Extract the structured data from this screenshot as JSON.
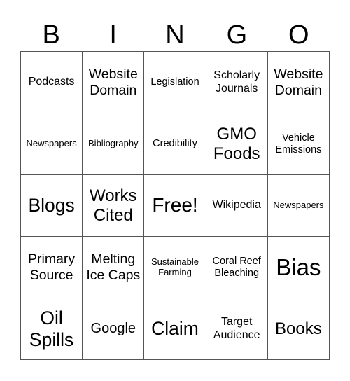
{
  "header": [
    "B",
    "I",
    "N",
    "G",
    "O"
  ],
  "cells": [
    [
      "Podcasts",
      "Website Domain",
      "Legislation",
      "Scholarly Journals",
      "Website Domain"
    ],
    [
      "Newspapers",
      "Bibliography",
      "Credibility",
      "GMO Foods",
      "Vehicle Emissions"
    ],
    [
      "Blogs",
      "Works Cited",
      "Free!",
      "Wikipedia",
      "Newspapers"
    ],
    [
      "Primary Source",
      "Melting Ice Caps",
      "Sustainable Farming",
      "Coral Reef Bleaching",
      "Bias"
    ],
    [
      "Oil Spills",
      "Google",
      "Claim",
      "Target Audience",
      "Books"
    ]
  ]
}
